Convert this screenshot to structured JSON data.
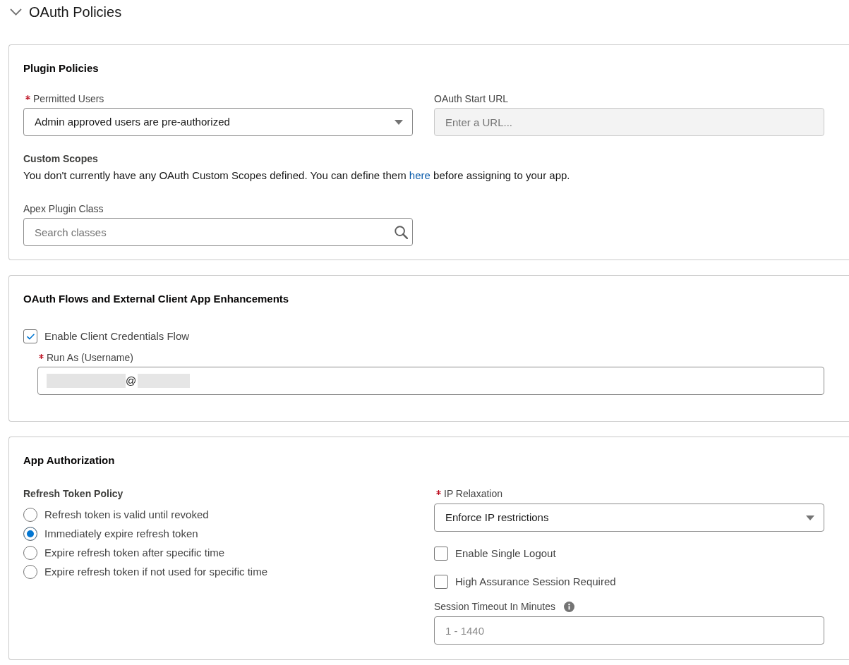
{
  "section": {
    "title": "OAuth Policies",
    "expanded": true
  },
  "plugin_policies": {
    "title": "Plugin Policies",
    "permitted_users": {
      "label": "Permitted Users",
      "required": true,
      "value": "Admin approved users are pre-authorized"
    },
    "oauth_start_url": {
      "label": "OAuth Start URL",
      "placeholder": "Enter a URL...",
      "disabled": true
    },
    "custom_scopes": {
      "title": "Custom Scopes",
      "text_before": "You don't currently have any OAuth Custom Scopes defined. You can define them ",
      "link": "here",
      "text_after": " before assigning to your app."
    },
    "apex_plugin_class": {
      "label": "Apex Plugin Class",
      "placeholder": "Search classes"
    }
  },
  "oauth_flows": {
    "title": "OAuth Flows and External Client App Enhancements",
    "client_credentials": {
      "label": "Enable Client Credentials Flow",
      "checked": true
    },
    "run_as": {
      "label": "Run As (Username)",
      "required": true,
      "value": "@",
      "redacted": true
    }
  },
  "app_authorization": {
    "title": "App Authorization",
    "refresh_token_policy": {
      "title": "Refresh Token Policy",
      "options": [
        {
          "label": "Refresh token is valid until revoked",
          "selected": false
        },
        {
          "label": "Immediately expire refresh token",
          "selected": true
        },
        {
          "label": "Expire refresh token after specific time",
          "selected": false
        },
        {
          "label": "Expire refresh token if not used for specific time",
          "selected": false
        }
      ]
    },
    "ip_relaxation": {
      "label": "IP Relaxation",
      "required": true,
      "value": "Enforce IP restrictions"
    },
    "checkboxes": [
      {
        "label": "Enable Single Logout",
        "checked": false
      },
      {
        "label": "High Assurance Session Required",
        "checked": false
      }
    ],
    "session_timeout": {
      "label": "Session Timeout In Minutes",
      "placeholder": "1 - 1440"
    }
  }
}
